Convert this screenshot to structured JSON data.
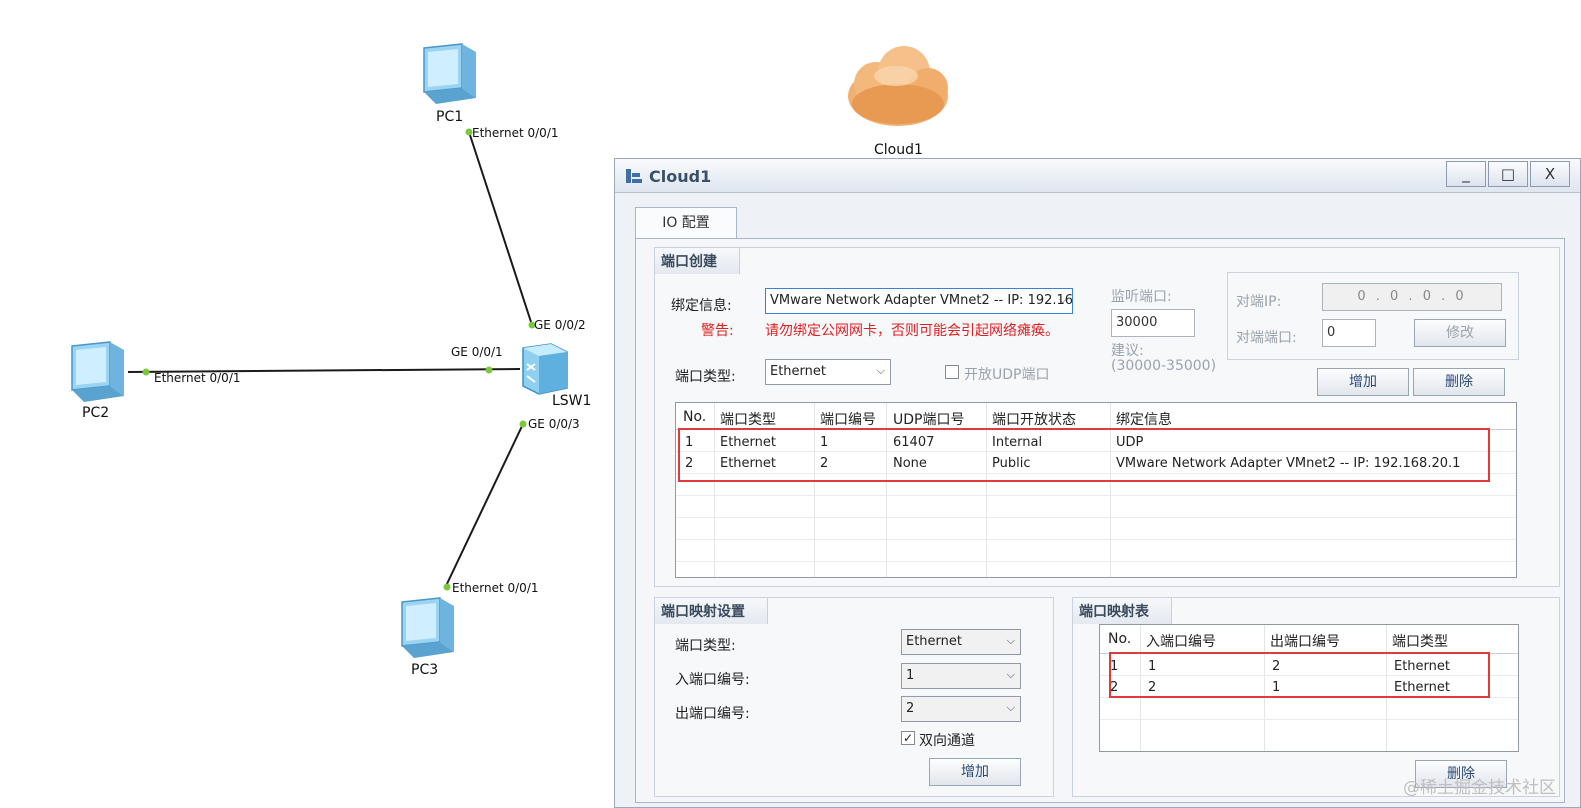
{
  "topology": {
    "devices": {
      "pc1": "PC1",
      "pc2": "PC2",
      "pc3": "PC3",
      "cloud": "Cloud1",
      "switch": "LSW1"
    },
    "ports": {
      "pc1_eth": "Ethernet 0/0/1",
      "pc2_eth": "Ethernet 0/0/1",
      "pc3_eth": "Ethernet 0/0/1",
      "sw_ge1": "GE 0/0/1",
      "sw_ge2": "GE 0/0/2",
      "sw_ge3": "GE 0/0/3"
    },
    "link_color": "#1a1a1a",
    "port_dot_color": "#7cc83c"
  },
  "window": {
    "title": "Cloud1",
    "minimize": "_",
    "maximize": "□",
    "close": "X",
    "tab": "IO 配置"
  },
  "port_create": {
    "title": "端口创建",
    "bind_label": "绑定信息:",
    "bind_value": "VMware Network Adapter VMnet2 -- IP: 192.16",
    "warn_label": "警告:",
    "warn_text": "请勿绑定公网网卡，否则可能会引起网络瘫痪。",
    "listen_label": "监听端口:",
    "listen_value": "30000",
    "suggest_label": "建议:",
    "suggest_range": "(30000-35000)",
    "peer_ip_label": "对端IP:",
    "peer_ip_value": "0 . 0 . 0 . 0",
    "peer_port_label": "对端端口:",
    "peer_port_value": "0",
    "modify_btn": "修改",
    "port_type_label": "端口类型:",
    "port_type_value": "Ethernet",
    "open_udp_label": "开放UDP端口",
    "add_btn": "增加",
    "delete_btn": "删除",
    "table": {
      "headers": [
        "No.",
        "端口类型",
        "端口编号",
        "UDP端口号",
        "端口开放状态",
        "绑定信息"
      ],
      "rows": [
        [
          "1",
          "Ethernet",
          "1",
          "61407",
          "Internal",
          "UDP"
        ],
        [
          "2",
          "Ethernet",
          "2",
          "None",
          "Public",
          "VMware Network Adapter VMnet2 -- IP: 192.168.20.1"
        ]
      ]
    }
  },
  "port_map_settings": {
    "title": "端口映射设置",
    "type_label": "端口类型:",
    "type_value": "Ethernet",
    "in_label": "入端口编号:",
    "in_value": "1",
    "out_label": "出端口编号:",
    "out_value": "2",
    "bidirectional_label": "双向通道",
    "bidirectional_checked": true,
    "add_btn": "增加"
  },
  "port_map_table": {
    "title": "端口映射表",
    "headers": [
      "No.",
      "入端口编号",
      "出端口编号",
      "端口类型"
    ],
    "rows": [
      [
        "1",
        "1",
        "2",
        "Ethernet"
      ],
      [
        "2",
        "2",
        "1",
        "Ethernet"
      ]
    ],
    "delete_btn": "删除"
  },
  "watermark": "@稀土掘金技术社区",
  "colors": {
    "highlight_box": "#e03a3a",
    "warning_text": "#e02020",
    "window_bg": "#eef1f6"
  }
}
